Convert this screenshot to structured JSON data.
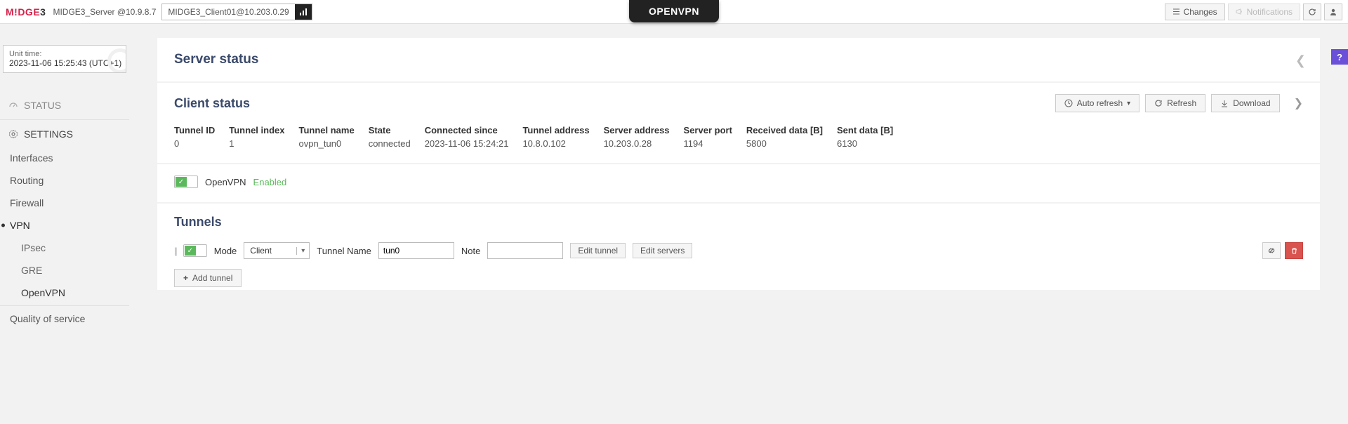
{
  "header": {
    "logo_m": "M!DGE",
    "logo_ver": "3",
    "server_label": "MIDGE3_Server @10.9.8.7",
    "client_label": "MIDGE3_Client01@10.203.0.29",
    "page_title": "OPENVPN",
    "changes_btn": "Changes",
    "notifications_btn": "Notifications"
  },
  "unit_time": {
    "label": "Unit time:",
    "value": "2023-11-06 15:25:43 (UTC+1)"
  },
  "nav": {
    "status": "STATUS",
    "settings": "SETTINGS",
    "interfaces": "Interfaces",
    "routing": "Routing",
    "firewall": "Firewall",
    "vpn": "VPN",
    "ipsec": "IPsec",
    "gre": "GRE",
    "openvpn": "OpenVPN",
    "qos": "Quality of service"
  },
  "server_status": {
    "title": "Server status"
  },
  "client_status": {
    "title": "Client status",
    "auto_refresh": "Auto refresh",
    "refresh": "Refresh",
    "download": "Download",
    "cols": {
      "tunnel_id": "Tunnel ID",
      "tunnel_index": "Tunnel index",
      "tunnel_name": "Tunnel name",
      "state": "State",
      "connected_since": "Connected since",
      "tunnel_address": "Tunnel address",
      "server_address": "Server address",
      "server_port": "Server port",
      "received": "Received data [B]",
      "sent": "Sent data [B]"
    },
    "row": {
      "tunnel_id": "0",
      "tunnel_index": "1",
      "tunnel_name": "ovpn_tun0",
      "state": "connected",
      "connected_since": "2023-11-06 15:24:21",
      "tunnel_address": "10.8.0.102",
      "server_address": "10.203.0.28",
      "server_port": "1194",
      "received": "5800",
      "sent": "6130"
    }
  },
  "openvpn_toggle": {
    "label": "OpenVPN",
    "state": "Enabled"
  },
  "tunnels": {
    "title": "Tunnels",
    "mode_label": "Mode",
    "mode_value": "Client",
    "name_label": "Tunnel Name",
    "name_value": "tun0",
    "note_label": "Note",
    "note_value": "",
    "edit_tunnel": "Edit tunnel",
    "edit_servers": "Edit servers",
    "add_tunnel": "Add tunnel"
  }
}
